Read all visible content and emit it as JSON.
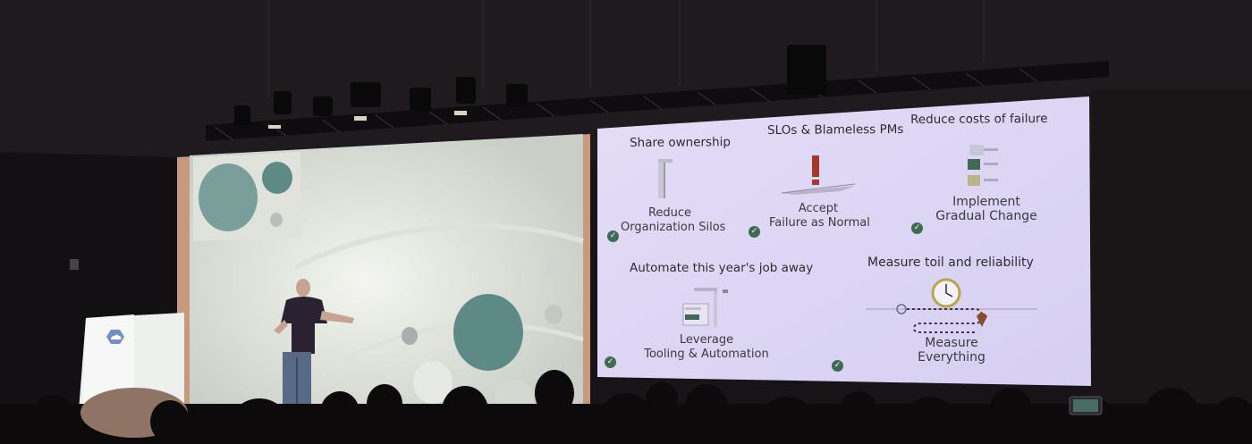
{
  "slide": {
    "items": [
      {
        "heading": "Share ownership",
        "caption_line1": "Reduce",
        "caption_line2": "Organization Silos",
        "icon": "tall-bracket-icon"
      },
      {
        "heading": "SLOs & Blameless PMs",
        "caption_line1": "Accept",
        "caption_line2": "Failure as Normal",
        "icon": "exclamation-icon"
      },
      {
        "heading": "Reduce costs of failure",
        "caption_line1": "Implement",
        "caption_line2": "Gradual Change",
        "icon": "stacked-cards-icon"
      },
      {
        "heading": "Automate this year's job away",
        "caption_line1": "Leverage",
        "caption_line2": "Tooling & Automation",
        "icon": "crane-icon"
      },
      {
        "heading": "Measure toil and reliability",
        "caption_line1": "Measure",
        "caption_line2": "Everything",
        "icon": "clock-path-icon"
      }
    ],
    "check_icon": "check-circle-icon",
    "colors": {
      "background": "#dcd6f4",
      "accent_dark": "#a03a2c",
      "check": "#3f6b55"
    }
  },
  "stage": {
    "backdrop_colors": {
      "wall": "#e9ece6",
      "circle": "#5d8a84",
      "frame": "#c79a80"
    },
    "podium_logo": "cloud-hexagon-logo"
  }
}
